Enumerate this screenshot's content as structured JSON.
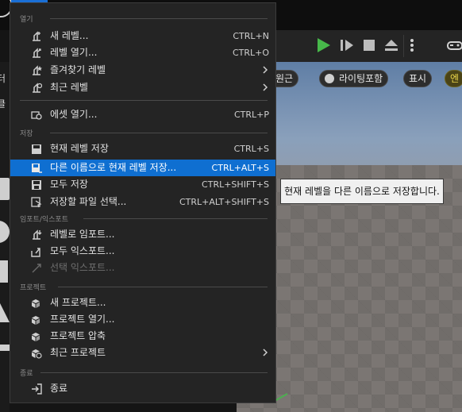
{
  "background": {
    "left_strip_fragments": [
      "터",
      "클"
    ],
    "viewport": {
      "chips": {
        "perspective": "원근",
        "lit": "라이팅포함",
        "show": "표시",
        "yellow": "엔"
      }
    }
  },
  "tooltip": "현재 레벨을 다른 이름으로 저장합니다.",
  "menu": {
    "sections": {
      "open": "열기",
      "save": "저장",
      "import_export": "임포트/익스포트",
      "project": "프로젝트",
      "exit": "종료"
    },
    "items": {
      "new_level": {
        "label": "새 레벨...",
        "shortcut": "CTRL+N"
      },
      "open_level": {
        "label": "레벨 열기...",
        "shortcut": "CTRL+O"
      },
      "favorite_levels": {
        "label": "즐겨찾기 레벨"
      },
      "recent_levels": {
        "label": "최근 레벨"
      },
      "open_asset": {
        "label": "에셋 열기...",
        "shortcut": "CTRL+P"
      },
      "save_current": {
        "label": "현재 레벨 저장",
        "shortcut": "CTRL+S"
      },
      "save_as": {
        "label": "다른 이름으로 현재 레벨 저장...",
        "shortcut": "CTRL+ALT+S"
      },
      "save_all": {
        "label": "모두 저장",
        "shortcut": "CTRL+SHIFT+S"
      },
      "choose_files": {
        "label": "저장할 파일 선택...",
        "shortcut": "CTRL+ALT+SHIFT+S"
      },
      "import_level": {
        "label": "레벨로 임포트..."
      },
      "export_all": {
        "label": "모두 익스포트..."
      },
      "export_selected": {
        "label": "선택 익스포트..."
      },
      "new_project": {
        "label": "새 프로젝트..."
      },
      "open_project": {
        "label": "프로젝트 열기..."
      },
      "zip_project": {
        "label": "프로젝트 압축"
      },
      "recent_projects": {
        "label": "최근 프로젝트"
      },
      "exit": {
        "label": "종료"
      }
    }
  },
  "colors": {
    "highlight": "#0f6fd1",
    "play_green": "#47b84a",
    "yellow_chip": "#e7d34a"
  }
}
